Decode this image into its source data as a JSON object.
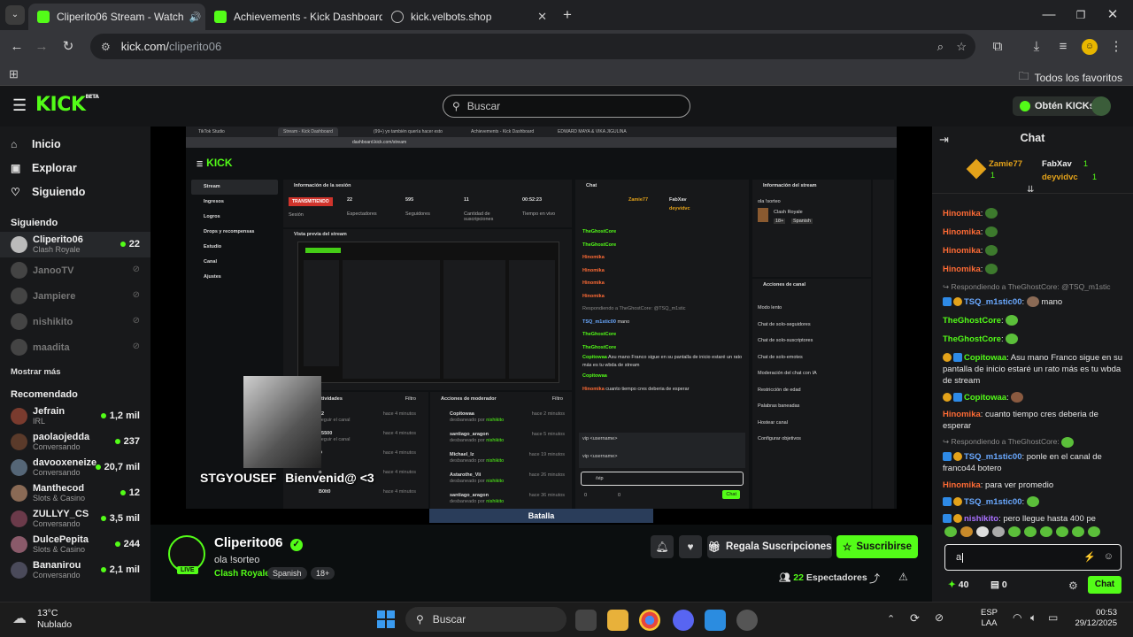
{
  "browser": {
    "tabs": [
      {
        "label": "Cliperito06 Stream - Watch",
        "favicon": "kick-icon",
        "active": true
      },
      {
        "label": "Achievements - Kick Dashboard",
        "favicon": "kick-icon",
        "active": false
      },
      {
        "label": "kick.velbots.shop",
        "favicon": "globe-icon",
        "active": false
      }
    ],
    "url_host": "kick.com/",
    "url_path": "cliperito06",
    "bookmarks_label": "Todos los favoritos"
  },
  "kick": {
    "logo": "KICK",
    "logo_beta": "BETA",
    "search_placeholder": "Buscar",
    "get_kicks": "Obtén KICKs",
    "accent": "#53fc18"
  },
  "sidebar": {
    "nav": [
      {
        "label": "Inicio",
        "icon": "home-icon"
      },
      {
        "label": "Explorar",
        "icon": "compass-icon"
      },
      {
        "label": "Siguiendo",
        "icon": "heart-icon"
      }
    ],
    "following_heading": "Siguiendo",
    "following": [
      {
        "name": "Cliperito06",
        "sub": "Clash Royale",
        "count": "22",
        "live": true
      },
      {
        "name": "JanooTV",
        "live": false
      },
      {
        "name": "Jampiere",
        "live": false
      },
      {
        "name": "nishikito",
        "live": false
      },
      {
        "name": "maadita",
        "live": false
      }
    ],
    "show_more": "Mostrar más",
    "recommended_heading": "Recomendado",
    "recommended": [
      {
        "name": "Jefrain",
        "sub": "IRL",
        "count": "1,2 mil"
      },
      {
        "name": "paolaojedda",
        "sub": "Conversando",
        "count": "237"
      },
      {
        "name": "davooxeneize",
        "sub": "Conversando",
        "count": "20,7 mil"
      },
      {
        "name": "Manthecod",
        "sub": "Slots & Casino",
        "count": "12"
      },
      {
        "name": "ZULLYY_CS",
        "sub": "Conversando",
        "count": "3,5 mil"
      },
      {
        "name": "DulcePepita",
        "sub": "Slots & Casino",
        "count": "244"
      },
      {
        "name": "Bananirou",
        "sub": "Conversando",
        "count": "2,1 mil"
      }
    ]
  },
  "dashboard": {
    "tabs": [
      "TikTok Studio",
      "Stream - Kick Dashboard",
      "(99+) yo también quería hacer esto",
      "Achievements - Kick Dashboard",
      "EDWARD MAYA & VIKA JIGULINA"
    ],
    "url": "dashboard.kick.com/stream",
    "menu": [
      "Stream",
      "Ingresos",
      "Logros",
      "Drops y recompensas",
      "Estudio",
      "Canal",
      "Ajustes"
    ],
    "session_title": "Información de la sesión",
    "live_badge": "TRANSMITIENDO",
    "stats": [
      {
        "value": "22",
        "label": "Espectadores"
      },
      {
        "value": "595",
        "label": "Seguidores"
      },
      {
        "value": "11",
        "label": "Cantidad de suscripciones"
      },
      {
        "value": "00:52:23",
        "label": "Tiempo en vivo"
      }
    ],
    "session_label": "Sesión",
    "preview_title": "Vista previa del stream",
    "activity_title": "Actividades",
    "filter": "Filtro",
    "mod_title": "Acciones de moderador",
    "mod_items": [
      {
        "name": "Copitowaa",
        "by": "nishikito",
        "time": "hace 2 minutos"
      },
      {
        "name": "santiago_aragon",
        "by": "nishikito",
        "time": "hace 5 minutos"
      },
      {
        "name": "Michael_lz",
        "by": "nishikito",
        "time": "hace 19 minutos"
      },
      {
        "name": "Astarothe_Vii",
        "by": "nishikito",
        "time": "hace 26 minutos"
      },
      {
        "name": "santiago_aragon",
        "by": "nishikito",
        "time": "hace 36 minutos"
      }
    ],
    "mod_action": "desbaneado por",
    "activity_items": [
      {
        "name": "12",
        "time": "hace 4 minutos"
      },
      {
        "name": "55500",
        "time": "hace 4 minutos"
      },
      {
        "name": "D",
        "time": "hace 4 minutos"
      },
      {
        "name": "o",
        "time": "hace 4 minutos"
      },
      {
        "name": "B0lt0",
        "time": "hace 4 minutos"
      }
    ],
    "activity_sub": "seguir el canal",
    "chat_title": "Chat",
    "chat_input": "/vip",
    "cmd_hint1": "vip <username>",
    "cmd_hint2": "vip <username>",
    "stream_info_title": "Información del stream",
    "stream_title": "ola !sorteo",
    "category": "Clash Royale",
    "tags": [
      "18+",
      "Spanish"
    ],
    "channel_actions_title": "Acciones de canal",
    "channel_actions": [
      "Modo lento",
      "Chat de solo-seguidores",
      "Chat de solo-suscriptores",
      "Chat de solo-emotes",
      "Moderación del chat con IA",
      "Restricción de edad",
      "Palabras baneadas",
      "Hostear canal",
      "Configurar objetivos"
    ],
    "chat_send": "Chat",
    "chat_counts": [
      "0",
      "0"
    ]
  },
  "overlay": {
    "welcome_name": "STGYOUSEF",
    "welcome_msg": "Bienvenid@ <3",
    "banner": "Batalla"
  },
  "stream_info": {
    "channel": "Cliperito06",
    "title": "ola !sorteo",
    "category": "Clash Royale",
    "tags": [
      "Spanish",
      "18+"
    ],
    "live_label": "LIVE",
    "gift_label": "Regala Suscripciones",
    "subscribe_label": "Suscribirse",
    "viewers_count": "22",
    "viewers_label": "Espectadores"
  },
  "chat": {
    "title": "Chat",
    "pinned_users": [
      {
        "name": "Zamie77",
        "value": "1"
      },
      {
        "name": "FabXav",
        "value": "1"
      },
      {
        "name": "deyvidvc",
        "value": "1"
      }
    ],
    "messages": [
      {
        "user": "Hinomika",
        "color": "#ff6b35",
        "text": "",
        "emote": true
      },
      {
        "user": "Hinomika",
        "color": "#ff6b35",
        "text": "",
        "emote": true
      },
      {
        "user": "Hinomika",
        "color": "#ff6b35",
        "text": "",
        "emote": true
      },
      {
        "user": "Hinomika",
        "color": "#ff6b35",
        "text": "",
        "emote": true
      },
      {
        "reply": "Respondiendo a TheGhostCore: @TSQ_m1stic"
      },
      {
        "user": "TSQ_m1stic00",
        "color": "#6aa9ff",
        "text": "mano",
        "emote": true
      },
      {
        "user": "TheGhostCore",
        "color": "#53fc18",
        "text": "",
        "emote": true
      },
      {
        "user": "TheGhostCore",
        "color": "#53fc18",
        "text": "",
        "emote": true
      },
      {
        "user": "Copitowaa",
        "color": "#53fc18",
        "text": "Asu mano Franco sigue en su pantalla de inicio estaré un rato más es tu wbda de stream"
      },
      {
        "user": "Copitowaa",
        "color": "#53fc18",
        "text": "",
        "emote": true
      },
      {
        "user": "Hinomika",
        "color": "#ff6b35",
        "text": "cuanto tiempo cres deberia de esperar",
        "emote": true
      },
      {
        "reply": "Respondiendo a TheGhostCore:"
      },
      {
        "user": "TSQ_m1stic00",
        "color": "#6aa9ff",
        "text": "ponle en el canal de franco44 botero"
      },
      {
        "user": "Hinomika",
        "color": "#ff6b35",
        "text": "para ver promedio"
      },
      {
        "user": "TSQ_m1stic00",
        "color": "#6aa9ff",
        "text": "",
        "emote": true
      },
      {
        "user": "nishikito",
        "color": "#a970ff",
        "text": "pero llegue hasta 400 pe",
        "emote": true
      }
    ],
    "input_value": "a",
    "points": "40",
    "zero": "0",
    "send_label": "Chat"
  },
  "taskbar": {
    "weather_temp": "13°C",
    "weather_desc": "Nublado",
    "search_label": "Buscar",
    "lang1": "ESP",
    "lang2": "LAA",
    "time": "00:53",
    "date": "29/12/2025"
  }
}
